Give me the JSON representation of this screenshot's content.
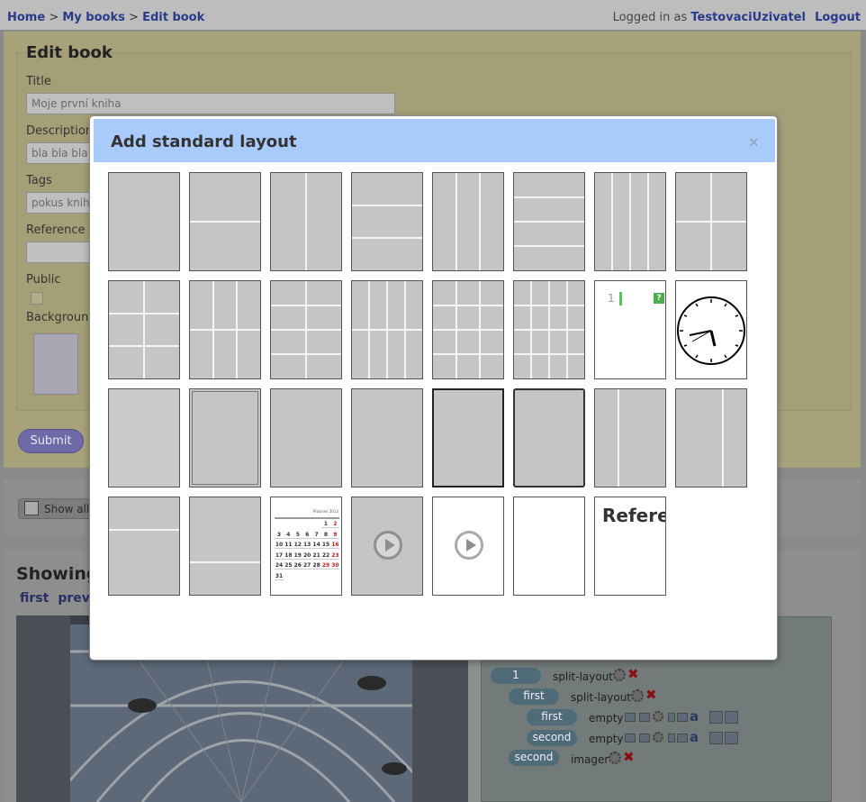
{
  "breadcrumbs": [
    "Home",
    "My books",
    "Edit book"
  ],
  "breadcrumb_sep": ">",
  "login": {
    "prefix": "Logged in as",
    "user": "TestovaciUzivatel",
    "logout": "Logout"
  },
  "edit": {
    "title": "Edit book",
    "fields": {
      "title_label": "Title",
      "title_value": "Moje první kniha",
      "description_label": "Description",
      "description_value": "bla bla bla",
      "tags_label": "Tags",
      "tags_value": "pokus kniha",
      "reference_label": "Reference",
      "reference_value": "",
      "public_label": "Public",
      "background_label": "Background"
    },
    "submit": "Submit"
  },
  "toolbar": {
    "show_all": "Show all"
  },
  "list": {
    "heading": "Showing",
    "pager": [
      "first",
      "previous"
    ]
  },
  "tree": [
    {
      "pill": "1",
      "name": "split-layout"
    },
    {
      "pill": "first",
      "name": "split-layout"
    },
    {
      "pill": "first",
      "name": "empty"
    },
    {
      "pill": "second",
      "name": "empty"
    },
    {
      "pill": "second",
      "name": "imager"
    }
  ],
  "modal": {
    "title": "Add standard layout",
    "close": "×",
    "code_line": "1",
    "code_badge": "?",
    "calendar_title": "Prosinec 2013",
    "calendar_rows": [
      [
        "",
        "",
        "",
        "",
        "",
        "1",
        "2"
      ],
      [
        "3",
        "4",
        "5",
        "6",
        "7",
        "8",
        "9"
      ],
      [
        "10",
        "11",
        "12",
        "13",
        "14",
        "15",
        "16"
      ],
      [
        "17",
        "18",
        "19",
        "20",
        "21",
        "22",
        "23"
      ],
      [
        "24",
        "25",
        "26",
        "27",
        "28",
        "29",
        "30"
      ],
      [
        "31",
        "",
        "",
        "",
        "",
        "",
        ""
      ]
    ],
    "reference_text": "Referen"
  }
}
